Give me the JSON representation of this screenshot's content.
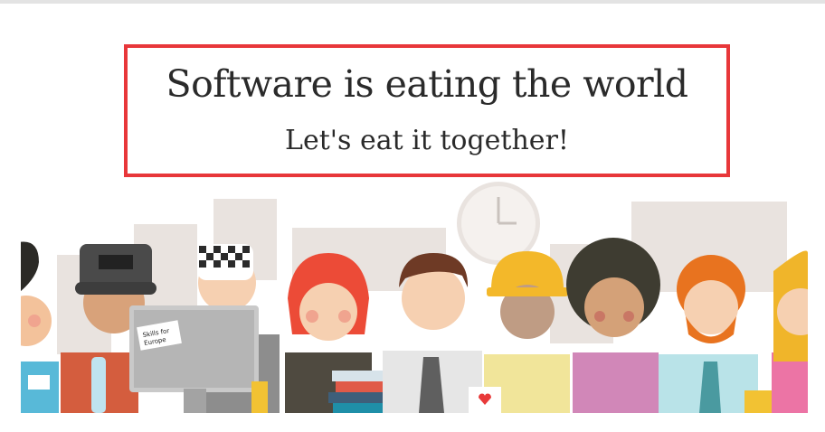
{
  "hero": {
    "title": "Software is eating the world",
    "subtitle": "Let's eat it together!"
  },
  "illustration": {
    "sticker_text_line1": "Skills for",
    "sticker_text_line2": "Europe",
    "colors": {
      "frame_border": "#e8373a",
      "panel_bg": "#e9e3df",
      "title_text": "#2a2a2a"
    }
  }
}
